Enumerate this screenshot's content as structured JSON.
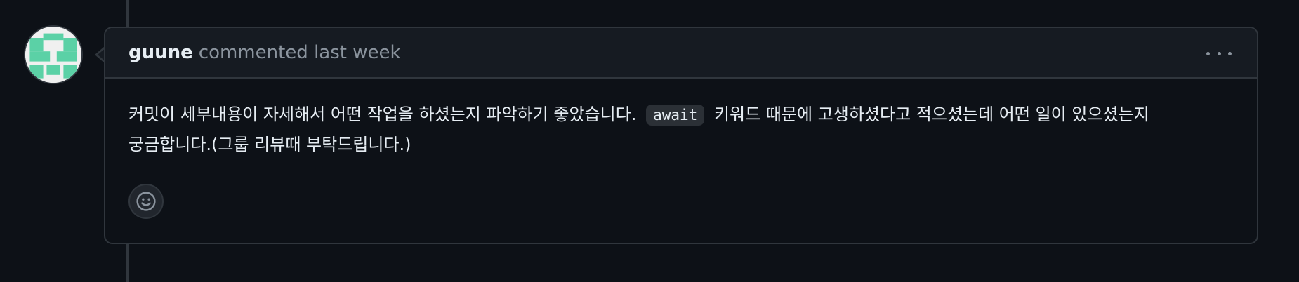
{
  "timeline": {
    "comment": {
      "author": "guune",
      "meta": "commented last week",
      "body": {
        "text_before": "커밋이 세부내용이 자세해서 어떤 작업을 하셨는지 파악하기 좋았습니다.",
        "code": "await",
        "text_after_line1": "키워드 때문에 고생하셨다고 적으셨는데 어떤 일이 있으셨는지",
        "text_line2": "궁금합니다.(그룹 리뷰때 부탁드립니다.)"
      },
      "menu_icon": "kebab-horizontal-icon",
      "reaction_icon": "smiley-icon"
    },
    "avatar": {
      "colors": {
        "pattern": "#5bd1a6",
        "background": "#f0f0f0"
      }
    }
  }
}
